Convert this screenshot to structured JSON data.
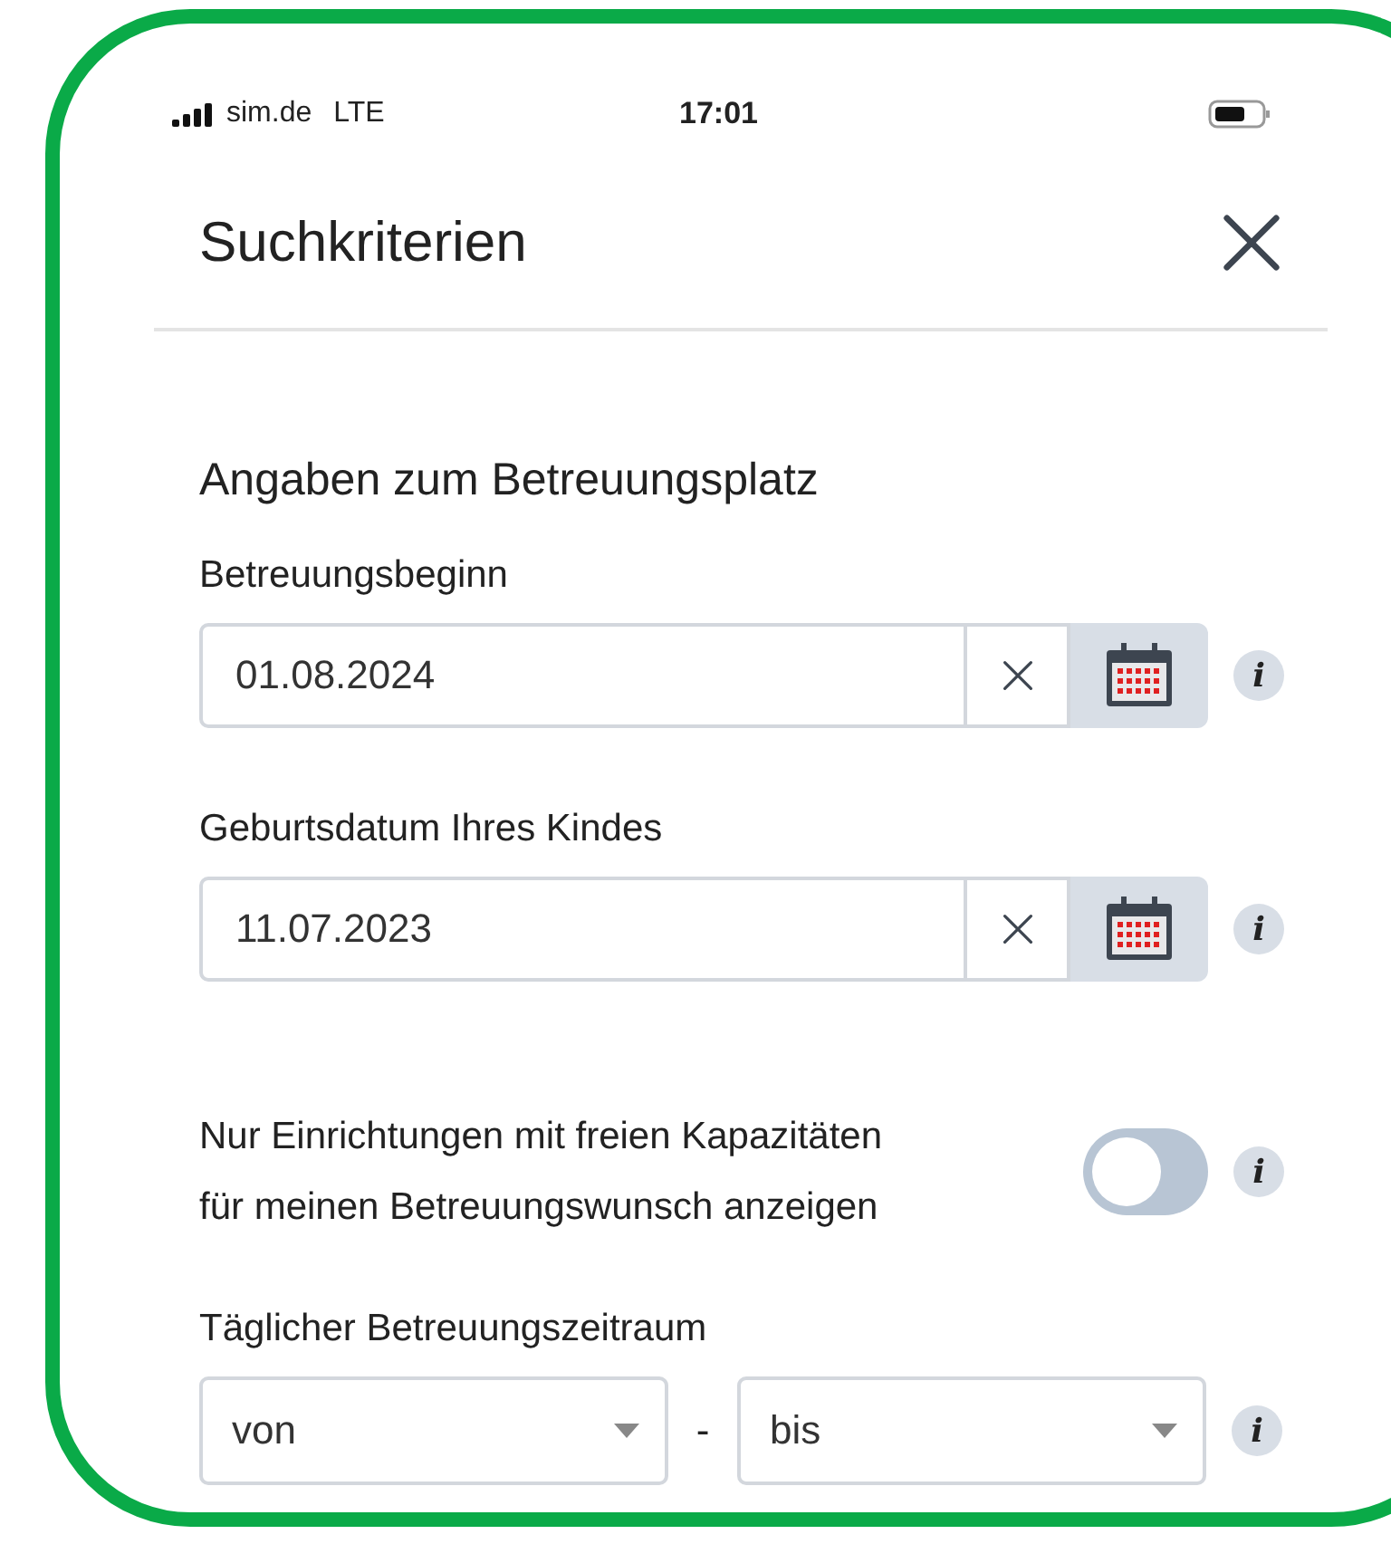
{
  "status_bar": {
    "carrier": "sim.de",
    "network": "LTE",
    "time": "17:01"
  },
  "header": {
    "title": "Suchkriterien"
  },
  "section": {
    "heading": "Angaben zum Betreuungsplatz",
    "date_fields": [
      {
        "label": "Betreuungsbeginn",
        "value": "01.08.2024",
        "info": "i"
      },
      {
        "label": "Geburtsdatum Ihres Kindes",
        "value": "11.07.2023",
        "info": "i"
      }
    ],
    "toggle": {
      "label_lines": [
        "Nur Einrichtungen mit freien Kapazitäten",
        "für meinen Betreuungswunsch anzeigen"
      ],
      "on": false,
      "info": "i"
    },
    "time_range": {
      "label": "Täglicher Betreuungszeitraum",
      "from_placeholder": "von",
      "separator": "-",
      "to_placeholder": "bis",
      "info": "i"
    }
  }
}
